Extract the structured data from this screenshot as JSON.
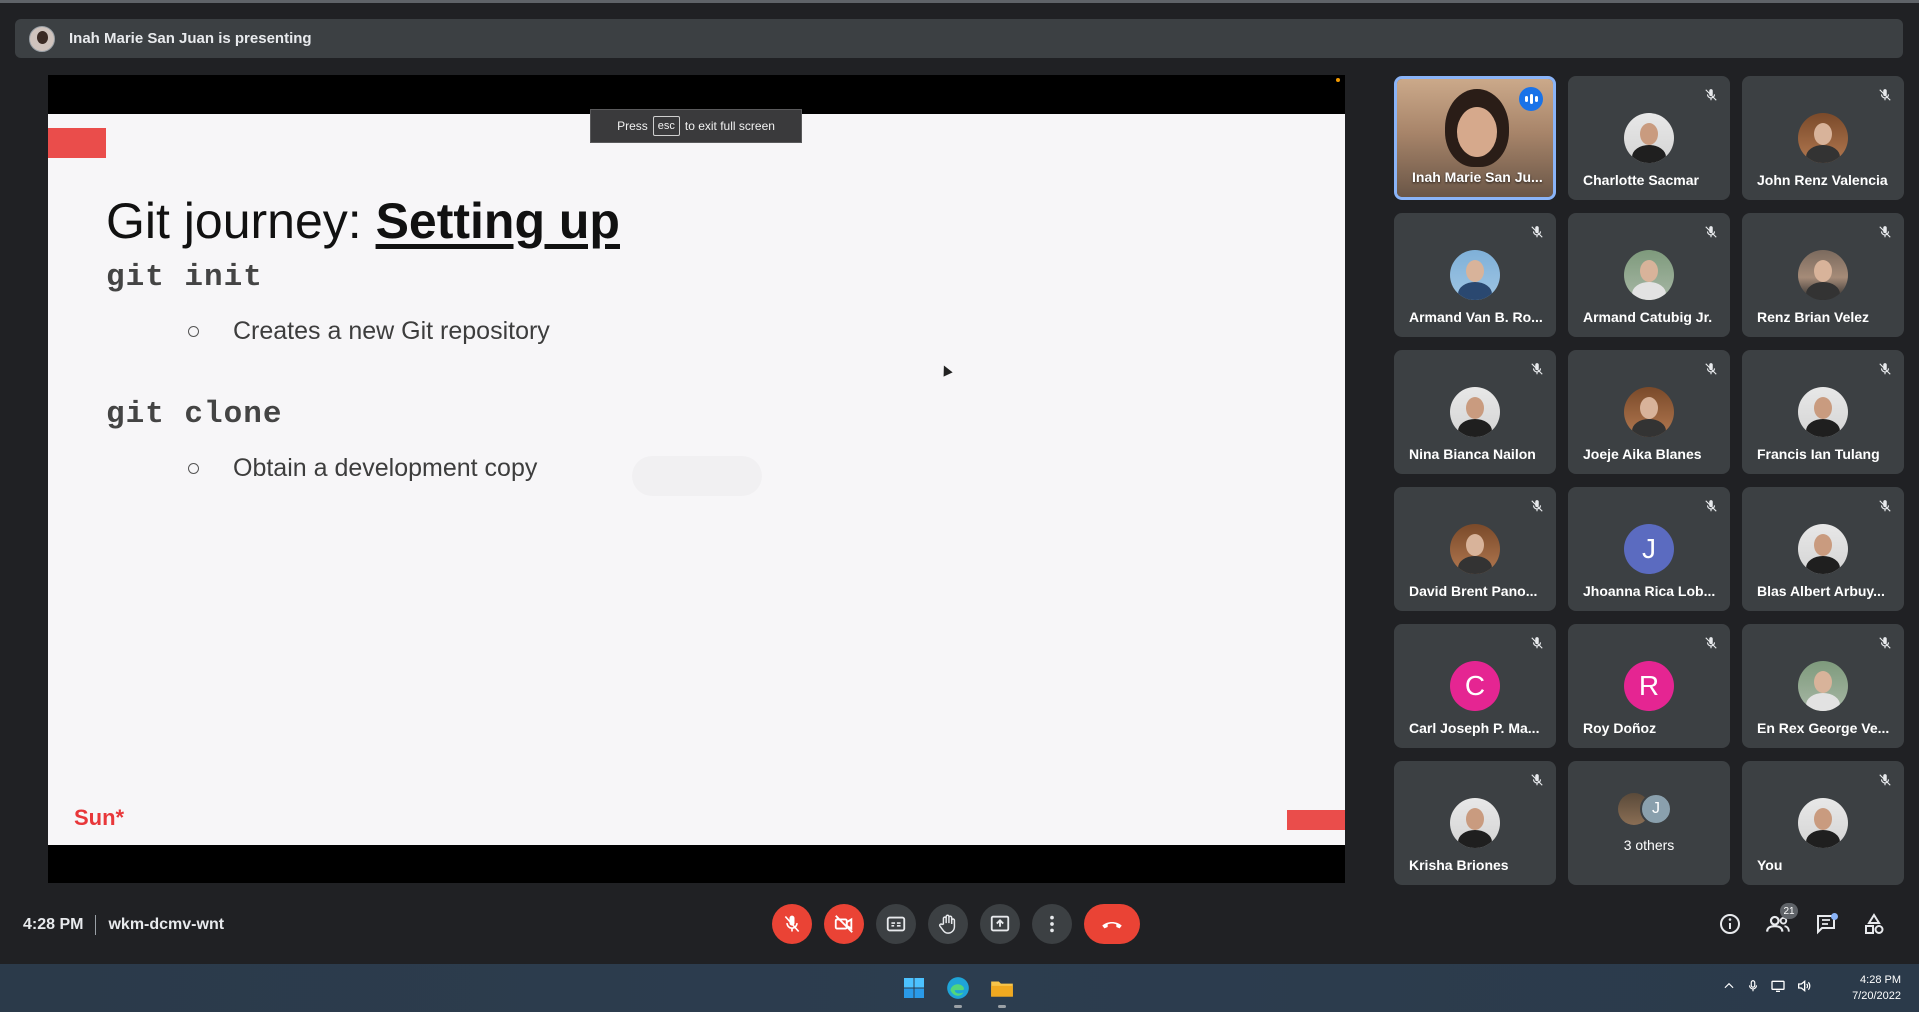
{
  "presenting_banner": {
    "text": "Inah Marie San Juan is presenting"
  },
  "slide": {
    "title_prefix": "Git journey: ",
    "title_emphasis": "Setting up",
    "items": [
      {
        "command": "git init",
        "bullet": "Creates a new Git repository"
      },
      {
        "command": "git clone",
        "bullet": "Obtain a development copy"
      }
    ],
    "logo": "Sun*"
  },
  "esc_hint": {
    "press": "Press",
    "key": "esc",
    "suffix": "to exit full screen"
  },
  "participants": [
    {
      "name": "Inah Marie San Ju...",
      "presenter": true
    },
    {
      "name": "Charlotte Sacmar"
    },
    {
      "name": "John Renz Valencia"
    },
    {
      "name": "Armand Van B. Ro..."
    },
    {
      "name": "Armand Catubig Jr."
    },
    {
      "name": "Renz Brian Velez"
    },
    {
      "name": "Nina Bianca Nailon"
    },
    {
      "name": "Joeje Aika Blanes"
    },
    {
      "name": "Francis Ian Tulang"
    },
    {
      "name": "David Brent Pano..."
    },
    {
      "name": "Jhoanna Rica Lob...",
      "initial": "J",
      "color": "#5b6bc0"
    },
    {
      "name": "Blas Albert Arbuy..."
    },
    {
      "name": "Carl Joseph P. Ma...",
      "initial": "C",
      "color": "#e52592"
    },
    {
      "name": "Roy Doñoz",
      "initial": "R",
      "color": "#e52592"
    },
    {
      "name": "En Rex George Ve..."
    },
    {
      "name": "Krisha Briones"
    },
    {
      "name": "3 others",
      "others_initial": "J"
    },
    {
      "name": "You"
    }
  ],
  "meeting": {
    "time": "4:28 PM",
    "code": "wkm-dcmv-wnt"
  },
  "toolbar": {
    "mic": "mic-off-icon",
    "camera": "camera-off-icon",
    "captions": "captions-icon",
    "raise_hand": "hand-icon",
    "present": "present-icon",
    "more": "more-vert-icon",
    "leave": "end-call-icon"
  },
  "right_tools": {
    "people_count": "21"
  },
  "taskbar": {
    "time": "4:28 PM",
    "date": "7/20/2022"
  },
  "colors": {
    "accent": "#8ab4f8",
    "danger": "#ea4335",
    "slide_red": "#ea4d4b",
    "bg": "#202124",
    "tile": "#3c4043"
  }
}
